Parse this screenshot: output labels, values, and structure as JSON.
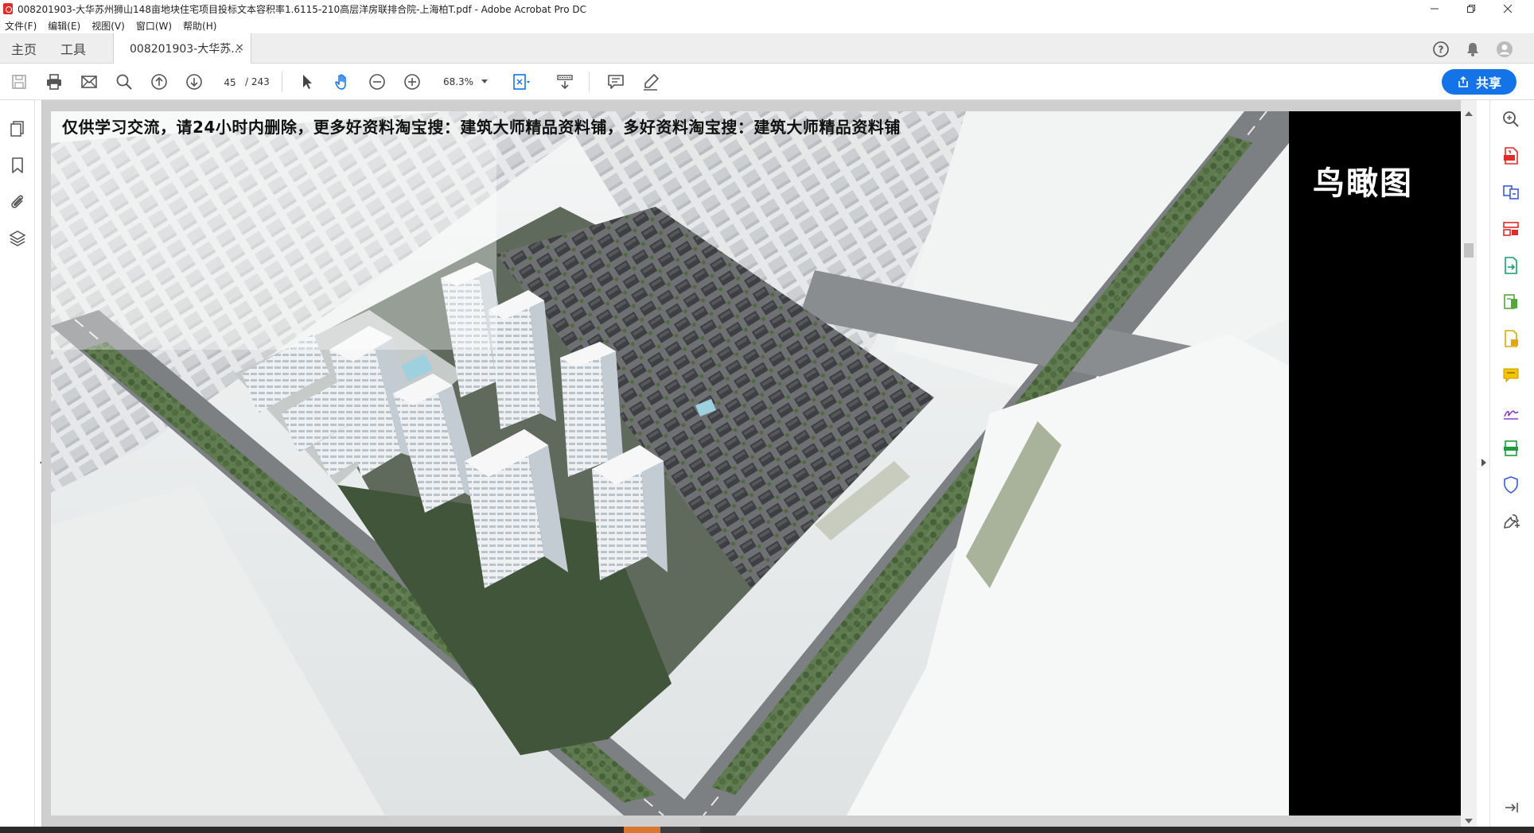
{
  "window": {
    "title": "008201903-大华苏州狮山148亩地块住宅项目投标文本容积率1.6115-210高层洋房联排合院-上海柏T.pdf - Adobe Acrobat Pro DC"
  },
  "menu": [
    "文件(F)",
    "编辑(E)",
    "视图(V)",
    "窗口(W)",
    "帮助(H)"
  ],
  "tabs": {
    "home": "主页",
    "tools": "工具",
    "document": "008201903-大华苏...",
    "close": "×"
  },
  "toolbar": {
    "current_page": "45",
    "total_pages": "/ 243",
    "zoom": "68.3%",
    "share_label": "共享"
  },
  "page": {
    "watermark": "仅供学习交流，请24小时内删除，更多好资料淘宝搜：建筑大师精品资料铺，多好资料淘宝搜：建筑大师精品资料铺",
    "title": "鸟瞰图"
  },
  "colors": {
    "accent": "#1473e6",
    "pdf_red": "#e02b2b"
  }
}
